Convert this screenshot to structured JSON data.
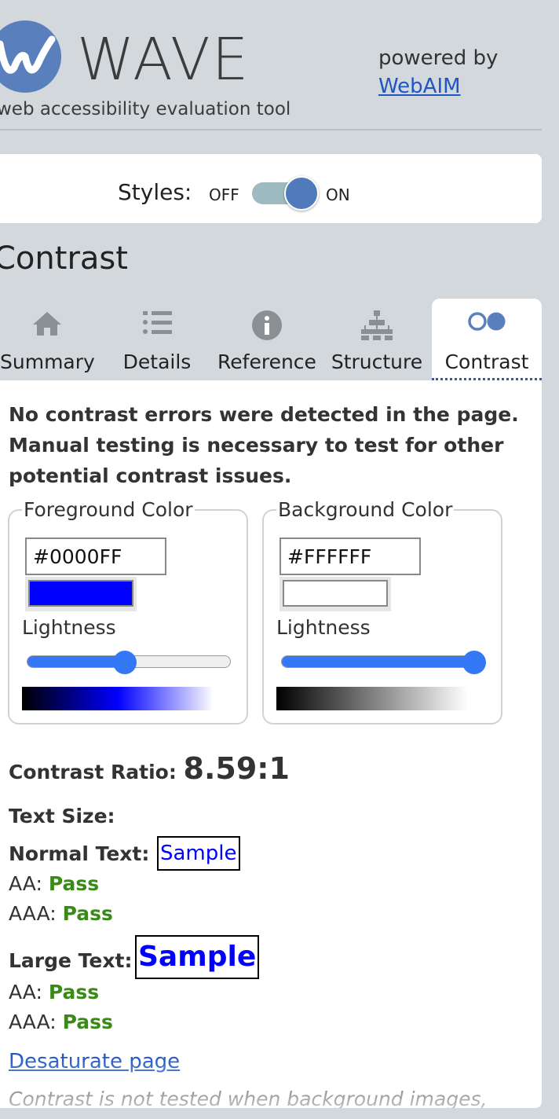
{
  "header": {
    "app_name": "WAVE",
    "tagline": "web accessibility evaluation tool",
    "powered_by": "powered by",
    "webaim_link": "WebAIM"
  },
  "styles_toggle": {
    "label": "Styles:",
    "off": "OFF",
    "on": "ON",
    "state": "on"
  },
  "section_title": "Contrast",
  "tabs": [
    {
      "label": "Summary",
      "icon": "home-icon",
      "active": false
    },
    {
      "label": "Details",
      "icon": "list-icon",
      "active": false
    },
    {
      "label": "Reference",
      "icon": "info-icon",
      "active": false
    },
    {
      "label": "Structure",
      "icon": "hierarchy-icon",
      "active": false
    },
    {
      "label": "Contrast",
      "icon": "contrast-circles-icon",
      "active": true
    }
  ],
  "contrast": {
    "intro": "No contrast errors were detected in the page. Manual testing is necessary to test for other potential contrast issues.",
    "foreground": {
      "legend": "Foreground Color",
      "value": "#0000FF",
      "lightness_label": "Lightness",
      "lightness_fraction": 0.5
    },
    "background": {
      "legend": "Background Color",
      "value": "#FFFFFF",
      "lightness_label": "Lightness",
      "lightness_fraction": 1.0
    },
    "ratio_label": "Contrast Ratio:",
    "ratio_value": "8.59:1",
    "text_size_label": "Text Size:",
    "normal_text_label": "Normal Text:",
    "large_text_label": "Large Text:",
    "sample": "Sample",
    "aa_label": "AA:",
    "aaa_label": "AAA:",
    "normal_aa": "Pass",
    "normal_aaa": "Pass",
    "large_aa": "Pass",
    "large_aaa": "Pass",
    "desaturate_link": "Desaturate page",
    "note": "Contrast is not tested when background images,"
  },
  "colors": {
    "accent": "#5a7fbd",
    "link": "#1f56c4",
    "pass": "#3a8a18",
    "slider": "#3478f6"
  }
}
